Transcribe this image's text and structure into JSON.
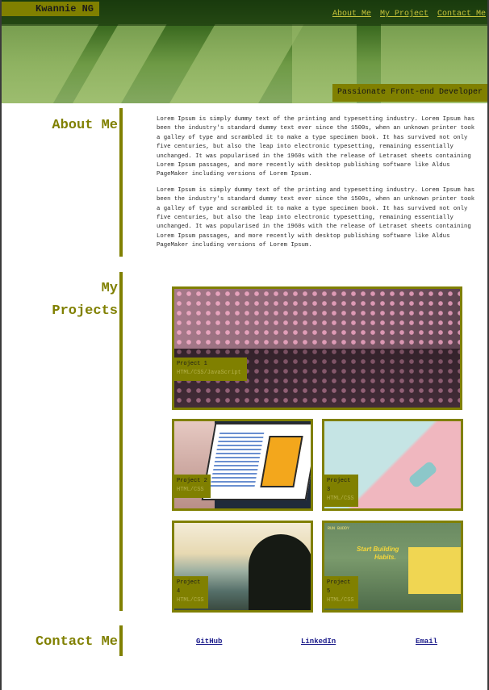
{
  "header": {
    "logo": "Kwannie NG",
    "nav": [
      "About Me",
      "My Project",
      "Contact Me"
    ],
    "tagline": "Passionate Front-end Developer"
  },
  "about": {
    "title": "About Me",
    "paragraphs": [
      "Lorem Ipsum is simply dummy text of the printing and typesetting industry. Lorem Ipsum has been the industry's standard dummy text ever since the 1500s, when an unknown printer took a galley of type and scrambled it to make a type specimen book. It has survived not only five centuries, but also the leap into electronic typesetting, remaining essentially unchanged. It was popularised in the 1960s with the release of Letraset sheets containing Lorem Ipsum passages, and more recently with desktop publishing software like Aldus PageMaker including versions of Lorem Ipsum.",
      "Lorem Ipsum is simply dummy text of the printing and typesetting industry. Lorem Ipsum has been the industry's standard dummy text ever since the 1500s, when an unknown printer took a galley of type and scrambled it to make a type specimen book. It has survived not only five centuries, but also the leap into electronic typesetting, remaining essentially unchanged. It was popularised in the 1960s with the release of Letraset sheets containing Lorem Ipsum passages, and more recently with desktop publishing software like Aldus PageMaker including versions of Lorem Ipsum."
    ]
  },
  "projects": {
    "title_line1": "My",
    "title_line2": "Projects",
    "items": [
      {
        "name": "Project 1",
        "tech": "HTML/CSS/JavaScript"
      },
      {
        "name": "Project 2",
        "tech": "HTML/CSS"
      },
      {
        "name": "Project 3",
        "tech": "HTML/CSS"
      },
      {
        "name": "Project 4",
        "tech": "HTML/CSS"
      },
      {
        "name": "Project 5",
        "tech": "HTML/CSS"
      }
    ],
    "run_buddy": {
      "brand": "RUN BUDDY",
      "headline1": "Start Building",
      "headline2": "Habits."
    }
  },
  "contact": {
    "title": "Contact Me",
    "links": [
      "GitHub",
      "LinkedIn",
      "Email"
    ]
  },
  "colors": {
    "accent": "#808000",
    "link": "#1a1a8a"
  }
}
